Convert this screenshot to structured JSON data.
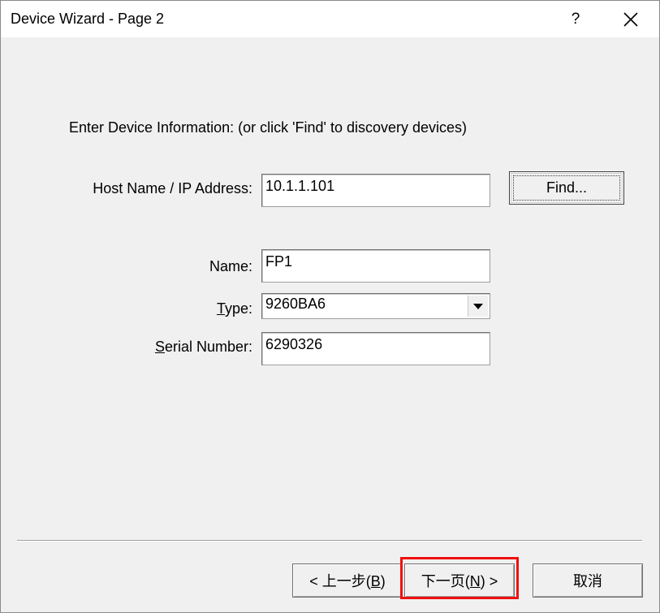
{
  "window": {
    "title": "Device Wizard - Page 2",
    "help_label": "?"
  },
  "instruction": "Enter Device Information: (or click 'Find' to discovery devices)",
  "host": {
    "label": "Host Name / IP Address:",
    "value": "10.1.1.101"
  },
  "find_button": {
    "label": "Find..."
  },
  "name_field": {
    "label": "Name:",
    "value": "FP1"
  },
  "type_field": {
    "label_accel": "T",
    "label_rest": "ype:",
    "value": "9260BA6"
  },
  "serial_field": {
    "label_accel": "S",
    "label_rest": "erial Number:",
    "value": "6290326"
  },
  "footer": {
    "back": {
      "prefix": "< 上一步(",
      "accel": "B",
      "suffix": ")"
    },
    "next": {
      "prefix": "下一页(",
      "accel": "N",
      "suffix": ") >"
    },
    "cancel": "取消"
  },
  "highlight_color": "#f01010"
}
